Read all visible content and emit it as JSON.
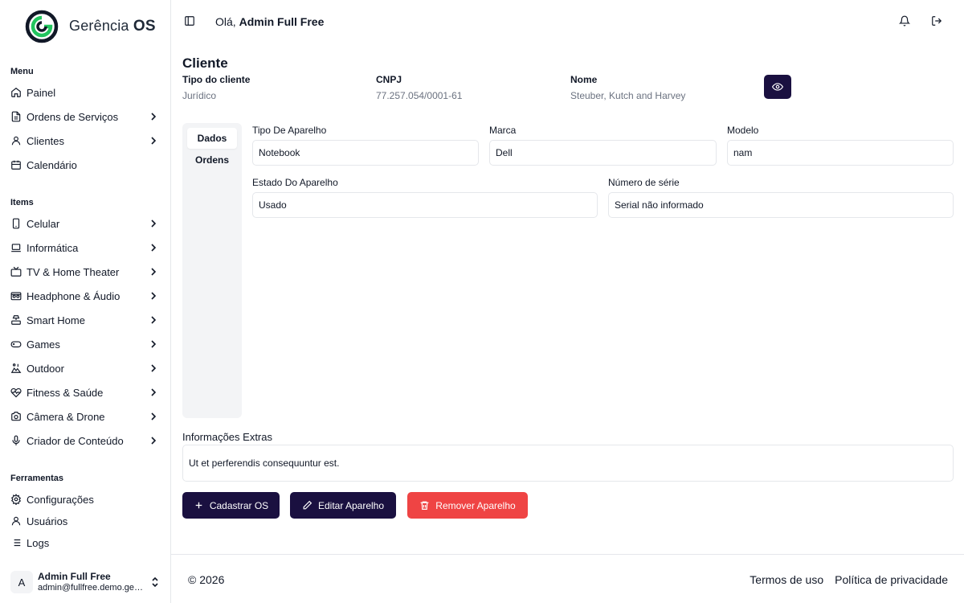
{
  "brand": {
    "name_light": "Gerência",
    "name_bold": "OS",
    "colors": {
      "primary": "#1a1040",
      "danger": "#ef4444",
      "logo_green": "#22c55e"
    }
  },
  "sidebar": {
    "sections": [
      {
        "title": "Menu",
        "items": [
          {
            "label": "Painel",
            "icon": "home-icon",
            "has_children": false
          },
          {
            "label": "Ordens de Serviços",
            "icon": "document-icon",
            "has_children": true
          },
          {
            "label": "Clientes",
            "icon": "user-icon",
            "has_children": true
          },
          {
            "label": "Calendário",
            "icon": "calendar-icon",
            "has_children": false
          }
        ]
      },
      {
        "title": "Items",
        "items": [
          {
            "label": "Celular",
            "icon": "smartphone-icon",
            "has_children": true
          },
          {
            "label": "Informática",
            "icon": "laptop-icon",
            "has_children": true
          },
          {
            "label": "TV & Home Theater",
            "icon": "tv-icon",
            "has_children": true
          },
          {
            "label": "Headphone & Áudio",
            "icon": "speaker-icon",
            "has_children": true
          },
          {
            "label": "Smart Home",
            "icon": "smart-home-icon",
            "has_children": true
          },
          {
            "label": "Games",
            "icon": "gamepad-icon",
            "has_children": true
          },
          {
            "label": "Outdoor",
            "icon": "outdoor-icon",
            "has_children": true
          },
          {
            "label": "Fitness & Saúde",
            "icon": "heart-pulse-icon",
            "has_children": true
          },
          {
            "label": "Câmera & Drone",
            "icon": "camera-icon",
            "has_children": true
          },
          {
            "label": "Criador de Conteúdo",
            "icon": "microphone-icon",
            "has_children": true
          }
        ]
      },
      {
        "title": "Ferramentas",
        "items": [
          {
            "label": "Configurações",
            "icon": "gear-icon",
            "has_children": false
          },
          {
            "label": "Usuários",
            "icon": "user-icon",
            "has_children": false
          },
          {
            "label": "Logs",
            "icon": "list-icon",
            "has_children": false
          }
        ]
      }
    ],
    "user": {
      "initial": "A",
      "name": "Admin Full Free",
      "email": "admin@fullfree.demo.gerenciaos.com"
    }
  },
  "header": {
    "greeting_prefix": "Olá,",
    "user_name": "Admin Full Free"
  },
  "client": {
    "title": "Cliente",
    "fields": [
      {
        "label": "Tipo do cliente",
        "value": "Jurídico"
      },
      {
        "label": "CNPJ",
        "value": "77.257.054/0001-61"
      },
      {
        "label": "Nome",
        "value": "Steuber, Kutch and Harvey"
      }
    ]
  },
  "tabs": [
    {
      "label": "Dados",
      "active": true
    },
    {
      "label": "Ordens",
      "active": false
    }
  ],
  "device": {
    "tipo": {
      "label": "Tipo De Aparelho",
      "value": "Notebook"
    },
    "marca": {
      "label": "Marca",
      "value": "Dell"
    },
    "modelo": {
      "label": "Modelo",
      "value": "nam"
    },
    "estado": {
      "label": "Estado Do Aparelho",
      "value": "Usado"
    },
    "serie": {
      "label": "Número de série",
      "value": "Serial não informado"
    }
  },
  "extras": {
    "label": "Informações Extras",
    "value": "Ut et perferendis consequuntur est."
  },
  "actions": {
    "cadastrar": "Cadastrar OS",
    "editar": "Editar Aparelho",
    "remover": "Remover Aparelho"
  },
  "footer": {
    "copyright": "© 2026",
    "terms": "Termos de uso",
    "privacy": "Política de privacidade"
  }
}
